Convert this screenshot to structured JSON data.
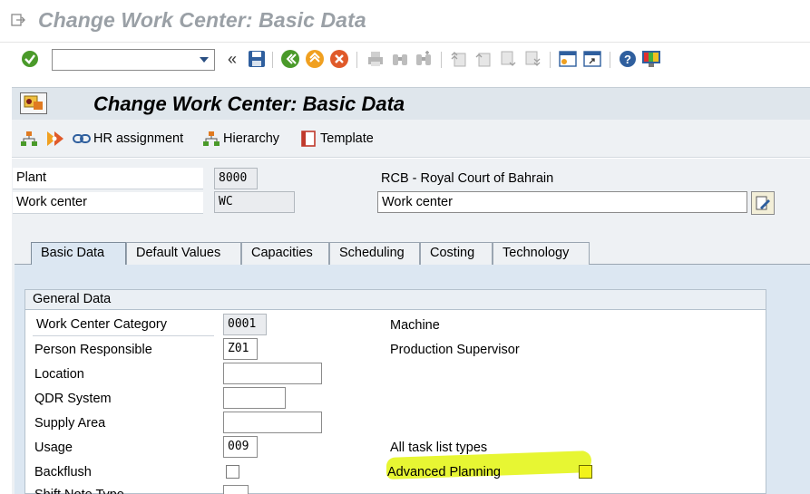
{
  "window": {
    "title": "Change Work Center: Basic Data"
  },
  "toolbar": {
    "command_value": ""
  },
  "header": {
    "title": "Change Work Center: Basic Data"
  },
  "app_toolbar": {
    "hr_assignment": "HR assignment",
    "hierarchy": "Hierarchy",
    "template": "Template"
  },
  "plant": {
    "label": "Plant",
    "value": "8000",
    "description": "RCB - Royal Court of Bahrain"
  },
  "work_center": {
    "label": "Work center",
    "value": "WC",
    "description": "Work center"
  },
  "tabs": [
    {
      "label": "Basic Data",
      "active": true
    },
    {
      "label": "Default Values"
    },
    {
      "label": "Capacities"
    },
    {
      "label": "Scheduling"
    },
    {
      "label": "Costing"
    },
    {
      "label": "Technology"
    }
  ],
  "general_data": {
    "title": "General Data",
    "category": {
      "label": "Work Center Category",
      "value": "0001",
      "description": "Machine"
    },
    "person": {
      "label": "Person Responsible",
      "value": "Z01",
      "description": "Production Supervisor"
    },
    "location": {
      "label": "Location",
      "value": ""
    },
    "qdr": {
      "label": "QDR System",
      "value": ""
    },
    "supply": {
      "label": "Supply Area",
      "value": ""
    },
    "usage": {
      "label": "Usage",
      "value": "009",
      "description": "All task list types"
    },
    "backflush": {
      "label": "Backflush",
      "checked": false
    },
    "advanced_planning": {
      "label": "Advanced Planning",
      "checked": false
    },
    "shift_note": {
      "label": "Shift Note Type"
    }
  },
  "colors": {
    "highlight": "#e4f51d",
    "tab_panel": "#dce7f2",
    "title_grey": "#9aa0a6"
  }
}
